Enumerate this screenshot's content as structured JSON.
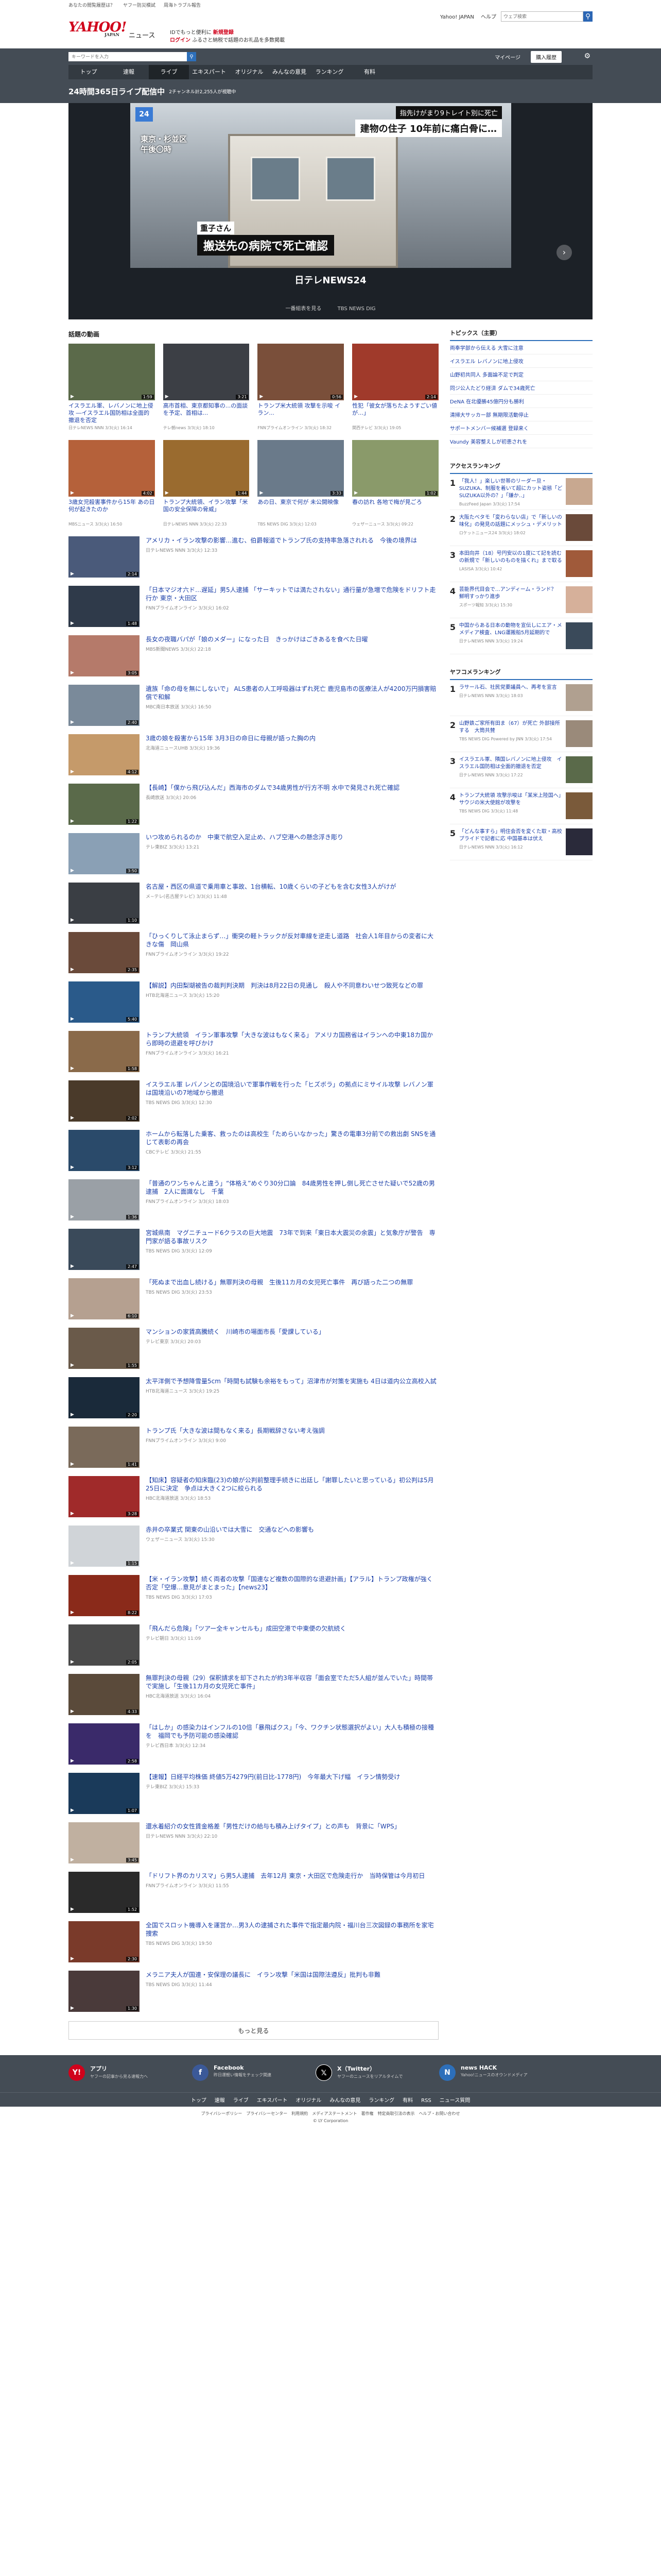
{
  "top_strip": [
    "あなたの閲覧履歴は？",
    "ヤフー防災模試",
    "周海トラブル報告"
  ],
  "brand": {
    "logo": "YAHOO!",
    "sub": "JAPAN",
    "service": "ニュース"
  },
  "promo": {
    "line1": "IDでもっと便利に",
    "line1_em": "新規登録",
    "line2": "ログイン",
    "line2_rest": "ふるさと納税で話題のお礼品を多数掲載"
  },
  "top_links": [
    "Yahoo! JAPAN",
    "ヘルプ"
  ],
  "top_search_placeholder": "ウェブ検索",
  "search": {
    "placeholder": "キーワードを入力",
    "mypage": "マイページ",
    "premium": "購入履歴"
  },
  "gnav": [
    "トップ",
    "速報",
    "ライブ",
    "エキスパート",
    "オリジナル",
    "みんなの意見",
    "ランキング",
    "有料"
  ],
  "gnav_active": 2,
  "live": {
    "title": "24時間365日ライブ配信中",
    "sub": "2チャンネル計2,255人が視聴中"
  },
  "hero": {
    "caption_a": "指先けがまり9トレイト別に死亡",
    "caption_b": "建物の住子 10年前に痛白骨に…",
    "location": [
      "東京・杉並区",
      "午後〇時"
    ],
    "telop_a": "重子さん",
    "telop_b": "搬送先の病院で死亡確認",
    "channel_logo": "日テレNEWS24",
    "foot": [
      "一番組表を見る",
      "TBS NEWS DIG"
    ]
  },
  "section_title": "話題の動画",
  "grid": [
    {
      "title": "イスラエル軍、レバノンに地上侵攻 ―イスラエル国防相は全面的撤退を否定",
      "meta": "日テレNEWS NNN",
      "time": "3/3(火) 16:14",
      "dur": "1:59",
      "color": "#5b6a4a"
    },
    {
      "title": "高市首相、東京都知事の...の面談を予定、首相は...",
      "meta": "テレ朝news",
      "time": "3/3(火) 18:10",
      "dur": "3:21",
      "color": "#3c3f45"
    },
    {
      "title": "トランプ米大統領 攻撃を示唆 イラン...",
      "meta": "FNNプライムオンライン",
      "time": "3/3(火) 18:32",
      "dur": "0:56",
      "color": "#7a4f3a"
    },
    {
      "title": "性犯「彼女が落ちたようすごい値が…」",
      "meta": "関西テレビ",
      "time": "3/3(火) 19:05",
      "dur": "2:14",
      "color": "#a03a2b"
    },
    {
      "title": "3歳女児殺害事件から15年 あの日何が起きたのか",
      "meta": "MBSニュース",
      "time": "3/3(火) 16:50",
      "dur": "4:02",
      "color": "#b5613a"
    },
    {
      "title": "トランプ大統領、イラン攻撃「米国の安全保障の脅威」",
      "meta": "日テレNEWS NNN",
      "time": "3/3(火) 22:33",
      "dur": "1:44",
      "color": "#9a6b2f"
    },
    {
      "title": "あの日、東京で何が 未公開映像",
      "meta": "TBS NEWS DIG",
      "time": "3/3(火) 12:03",
      "dur": "3:33",
      "color": "#6a7a8a"
    },
    {
      "title": "春の訪れ 各地で梅が見ごろ",
      "meta": "ウェザーニュース",
      "time": "3/3(火) 09:22",
      "dur": "1:02",
      "color": "#8a9a6a"
    }
  ],
  "list": [
    {
      "title": "アメリカ・イラン攻撃の影響…進む、伯爵報道でトランプ氏の支持率急落されれる　今後の境界は",
      "meta": "日テレNEWS NNN",
      "time": "3/3(火) 12:33",
      "dur": "2:14",
      "color": "#4a5a7a"
    },
    {
      "title": "「日本マジオ六ド…遅延」男5人逮捕 「サーキットでは満たされない」通行量が急増で危険をドリフト走行か 東京・大田区",
      "meta": "FNNプライムオンライン",
      "time": "3/3(火) 16:02",
      "dur": "1:48",
      "color": "#2f3a4a"
    },
    {
      "title": "長女の夜職バパが「娘のメダー」になった日　きっかけはごきあるを食べた日曜",
      "meta": "MBS新聞NEWS",
      "time": "3/3(火) 22:18",
      "dur": "3:05",
      "color": "#b57a6a"
    },
    {
      "title": "遺族「命の母を無にしないで」 ALS患者の人工呼吸器はずれ死亡 鹿児島市の医療法人が4200万円損害賠償で和解",
      "meta": "MBC南日本放送",
      "time": "3/3(火) 16:50",
      "dur": "2:40",
      "color": "#7a8a9a"
    },
    {
      "title": "3歳の娘を殺害から15年 3月3日の命日に母親が語った胸の内",
      "meta": "北海道ニュースUHB",
      "time": "3/3(火) 19:36",
      "dur": "4:12",
      "color": "#c59a6a"
    },
    {
      "title": "【長崎】「僕から飛び込んだ」西海市のダムで34歳男性が行方不明 水中で発見され死亡確認",
      "meta": "長崎放送",
      "time": "3/3(火) 20:06",
      "dur": "1:22",
      "color": "#5a6a4a"
    },
    {
      "title": "いつ攻められるのか　中東で航空入足止め、ハブ空港への懸念浮き彫り",
      "meta": "テレ東BIZ",
      "time": "3/3(火) 13:21",
      "dur": "3:50",
      "color": "#8aa0b5"
    },
    {
      "title": "名古屋・西区の県道で乗用車と事故、1台横転、10歳くらいの子どもを含む女性3人がけが",
      "meta": "メ~テレ(名古屋テレビ)",
      "time": "3/3(火) 11:48",
      "dur": "1:10",
      "color": "#3a3e44"
    },
    {
      "title": "「ひっくりして泳止まらず…」衝突の軽トラックが反対車線を逆走し道路　社会人1年目からの変者に大きな傷　岡山県",
      "meta": "FNNプライムオンライン",
      "time": "3/3(火) 19:22",
      "dur": "2:35",
      "color": "#6a4a3a"
    },
    {
      "title": "【解説】内田梨瑚被告の裁判判決期　判決は8月22日の見通し　殺人や不同意わいせつ致死などの罪",
      "meta": "HTB北海道ニュース",
      "time": "3/3(火) 15:20",
      "dur": "5:40",
      "color": "#2a5a8a"
    },
    {
      "title": "トランプ大統領　イラン軍事攻撃「大きな波はもなく来る」 アメリカ国務省はイランへの中東18カ国から即時の退避を呼びかけ",
      "meta": "FNNプライムオンライン",
      "time": "3/3(火) 16:21",
      "dur": "1:58",
      "color": "#8a6a4a"
    },
    {
      "title": "イスラエル軍 レバノンとの国境沿いで軍事作戦を行った「ヒズボラ」の拠点にミサイル攻撃 レバノン軍は国境沿いの7地域から撤退",
      "meta": "TBS NEWS DIG",
      "time": "3/3(火) 12:30",
      "dur": "2:02",
      "color": "#4a3a2a"
    },
    {
      "title": "ホームから転落した乗客、救ったのは高校生「ためらいなかった」驚きの電車3分前での救出劇 SNSを通じて表彰の再会",
      "meta": "CBCテレビ",
      "time": "3/3(火) 21:55",
      "dur": "3:12",
      "color": "#2a4a6a"
    },
    {
      "title": "「普通のワンちゃんと違う」“体格え”めぐり30分口論　84歳男性を押し倒し死亡させた疑いで52歳の男逮捕　2人に面識なし　千葉",
      "meta": "FNNプライムオンライン",
      "time": "3/3(火) 18:03",
      "dur": "1:36",
      "color": "#9aa0a6"
    },
    {
      "title": "宮城県南　マグニチュード6クラスの巨大地震　73年で到来「東日本大震災の余震」と気象庁が警告　専門家が語る事故リスク",
      "meta": "TBS NEWS DIG",
      "time": "3/3(火) 12:09",
      "dur": "2:47",
      "color": "#3a4a5a"
    },
    {
      "title": "「死ぬまで出血し続ける」無罪判決の母親　生後11カ月の女児死亡事件　再び語った二つの無罪",
      "meta": "TBS NEWS DIG",
      "time": "3/3(火) 23:53",
      "dur": "6:10",
      "color": "#b5a090"
    },
    {
      "title": "マンションの家賃高騰続く　川崎市の場面市長「愛課している」",
      "meta": "テレビ東京",
      "time": "3/3(火) 20:03",
      "dur": "1:55",
      "color": "#6a5a4a"
    },
    {
      "title": "太平洋側で予想降雪量5cm「時間も試験も余裕をもって」沼津市が対策を実施も 4日は道内公立高校入試",
      "meta": "HTB北海道ニュース",
      "time": "3/3(火) 19:25",
      "dur": "2:20",
      "color": "#1a2a3a"
    },
    {
      "title": "トランプ氏「大きな波は間もなく来る」長期戦辞さない考え強調",
      "meta": "FNNプライムオンライン",
      "time": "3/3(火) 9:00",
      "dur": "1:41",
      "color": "#7a6a5a"
    },
    {
      "title": "【知床】容疑者の知床臨(23)の娘が公判前整理手続きに出廷し「謝罪したいと思っている」初公判は5月25日に決定　争点は大きく2つに絞られる",
      "meta": "HBC北海道放送",
      "time": "3/3(火) 18:53",
      "dur": "3:28",
      "color": "#a02a2a"
    },
    {
      "title": "赤井の卒業式 関東の山沿いでは大雪に　交通などへの影響も",
      "meta": "ウェザーニュース",
      "time": "3/3(火) 15:30",
      "dur": "1:15",
      "color": "#d0d4d8"
    },
    {
      "title": "【米・イラン攻撃】続く両者の攻撃「国連など複数の国際的な退避計画」【アラル】トランプ政権が強く否定「空爆…意見がまとまった」【news23】",
      "meta": "TBS NEWS DIG",
      "time": "3/3(火) 17:03",
      "dur": "8:22",
      "color": "#8a2a1a"
    },
    {
      "title": "「飛んだら危険」「ツアー全キャンセルも」成田空港で中東便の欠航続く",
      "meta": "テレビ朝日",
      "time": "3/3(火) 11:09",
      "dur": "2:05",
      "color": "#4a4a4a"
    },
    {
      "title": "無罪判決の母親（29）保釈請求を却下されたが約3年半収容「面会室でただ5人組が並んでいた」時間帯で実施し「生後11カ月の女児死亡事件」",
      "meta": "HBC北海道放送",
      "time": "3/3(火) 16:04",
      "dur": "4:33",
      "color": "#5a4a3a"
    },
    {
      "title": "「はしか」の感染力はインフルの10倍「暴飛ばクス」「今、ワクチン状態選択がよい」大人も積極の接種を　福岡でも予防可能の感染確認",
      "meta": "テレビ西日本",
      "time": "3/3(火) 12:34",
      "dur": "2:58",
      "color": "#3a2a6a"
    },
    {
      "title": "【速報】日経平均株価 終値5万4279円(前日比-1778円)　今年最大下げ幅　イラン情勢受け",
      "meta": "テレ東BIZ",
      "time": "3/3(火) 15:33",
      "dur": "1:07",
      "color": "#1a3a5a"
    },
    {
      "title": "還水着紹介の女性賃金格差「男性だけの給与も積み上げタイプ」との声も　背景に「WPS」",
      "meta": "日テレNEWS NNN",
      "time": "3/3(火) 22:10",
      "dur": "3:45",
      "color": "#c0b0a0"
    },
    {
      "title": "「ドリフト界のカリスマ」ら男5人逮捕　去年12月 東京・大田区で危険走行か　当時保管は今月初日",
      "meta": "FNNプライムオンライン",
      "time": "3/3(火) 11:55",
      "dur": "1:52",
      "color": "#2a2a2a"
    },
    {
      "title": "全国でスロット機導入を運営か…男3人の逮捕された事件で指定最内院・福川台三次図録の事務所を家宅捜索",
      "meta": "TBS NEWS DIG",
      "time": "3/3(火) 19:50",
      "dur": "2:30",
      "color": "#7a3a2a"
    },
    {
      "title": "メラニア夫人が国連・安保理の議長に　イラン攻撃「米国は国際法遵反」批判も非難",
      "meta": "TBS NEWS DIG",
      "time": "3/3(火) 11:44",
      "dur": "1:30",
      "color": "#4a3a3a"
    }
  ],
  "more_label": "もっと見る",
  "topics": {
    "title": "トピックス（主要）",
    "items": [
      "両奉学部から伝える 大雪に注意",
      "イスラエル レバノンに地上侵攻",
      "山野初共同人 多面論不足で判定",
      "同ジ公人たどり経済 ダムで34歳死亡",
      "DeNA 在北優勝45億円分も勝利",
      "清掃大サッカー部 無期限活動停止",
      "サポートメンバー候補選 登録来く",
      "Vaundy 美容整えしが初患されを"
    ]
  },
  "access": {
    "title": "アクセスランキング",
    "items": [
      {
        "n": "1",
        "title": "「我人！」楽しい世帯のリーダー旦・SUZUKA、制服を着いて超にカット姿態「どSUZUKA以外の？」「嫌か‥」",
        "meta": "BuzzFeed Japan",
        "time": "3/3(火) 17:54",
        "color": "#c8a890"
      },
      {
        "n": "2",
        "title": "大阪たべタモ「変わらない店」で「新しいの味化」の発見の話題にメッシュ・デメリット",
        "meta": "ロケットニュース24",
        "time": "3/3(火) 18:02",
        "color": "#6a4a3a"
      },
      {
        "n": "3",
        "title": "本田向井（18）号円安以の1度にて記を読むの新規で「新しいのものを描くれ」まで取る",
        "meta": "LASISA",
        "time": "3/3(火) 10:42",
        "color": "#a05a3a"
      },
      {
        "n": "4",
        "title": "芸能界代目会で…アンディーム・ランド？ 鮮明すっかり進歩",
        "meta": "スポーツ報知",
        "time": "3/3(火) 15:30",
        "color": "#d6b09a"
      },
      {
        "n": "5",
        "title": "中国からある日本の動物を宣伝しにエア・メメディア検査、LNG運搬船5月延期的で",
        "meta": "日テレNEWS NNN",
        "time": "3/3(火) 19:24",
        "color": "#3a4a5a"
      }
    ]
  },
  "comment": {
    "title": "ヤフコメランキング",
    "items": [
      {
        "n": "1",
        "title": "ラサール石、社民党要議員へ、再考を宣言",
        "meta": "日テレNEWS NNN",
        "time": "3/3(火) 18:03",
        "color": "#b0a090"
      },
      {
        "n": "2",
        "title": "山野鉄ご家所有田ま（67）が死亡 外部接所する　大筒共賛",
        "meta": "TBS NEWS DIG Powered by JNN",
        "time": "3/3(火) 17:54",
        "color": "#9a8a7a"
      },
      {
        "n": "3",
        "title": "イスラエル軍、隣国レバノンに地上侵攻　イスラエル国防相は全面的撤退を否定",
        "meta": "日テレNEWS NNN",
        "time": "3/3(火) 17:22",
        "color": "#5a6a4a"
      },
      {
        "n": "4",
        "title": "トランプ大統領 攻撃示唆は「某米上陸国へ」サウジの米大使館が攻撃を",
        "meta": "TBS NEWS DIG",
        "time": "3/3(火) 11:48",
        "color": "#7a5a3a"
      },
      {
        "n": "5",
        "title": "「どんな事すら」明住会否を変くた取・高校プライドで記者に応 中国基本は伏え",
        "meta": "日テレNEWS NNN",
        "time": "3/3(火) 16:12",
        "color": "#2a2a3a"
      }
    ]
  },
  "footer": {
    "apps": [
      {
        "name": "アプリ",
        "desc": "ヤフーの記事から見る速報力へ",
        "icon": "Y!",
        "color": "#d0021b"
      },
      {
        "name": "Facebook",
        "desc": "昨日運軽い情報をチェック関連",
        "icon": "f",
        "color": "#3b5998"
      },
      {
        "name": "X（Twitter）",
        "desc": "ヤフーのニュースをリアルタイムで",
        "icon": "𝕏",
        "color": "#000"
      },
      {
        "name": "news HACK",
        "desc": "Yahoo!ニュースのオウンドメディア",
        "icon": "N",
        "color": "#2d6fba"
      }
    ],
    "nav": [
      "トップ",
      "速報",
      "ライブ",
      "エキスパート",
      "オリジナル",
      "みんなの意見",
      "ランキング",
      "有料",
      "RSS",
      "ニュース質問"
    ],
    "bottom": [
      "プライバシーポリシー",
      "プライバシーセンター",
      "利用規約",
      "メディアステートメント",
      "著作権",
      "特定商取引法の表示",
      "ヘルプ・お問い合わせ"
    ],
    "copyright": "© LY Corporation"
  },
  "colors": {
    "accent": "#d0021b",
    "link": "#1a3ea8",
    "nav_bg": "#444c55"
  }
}
